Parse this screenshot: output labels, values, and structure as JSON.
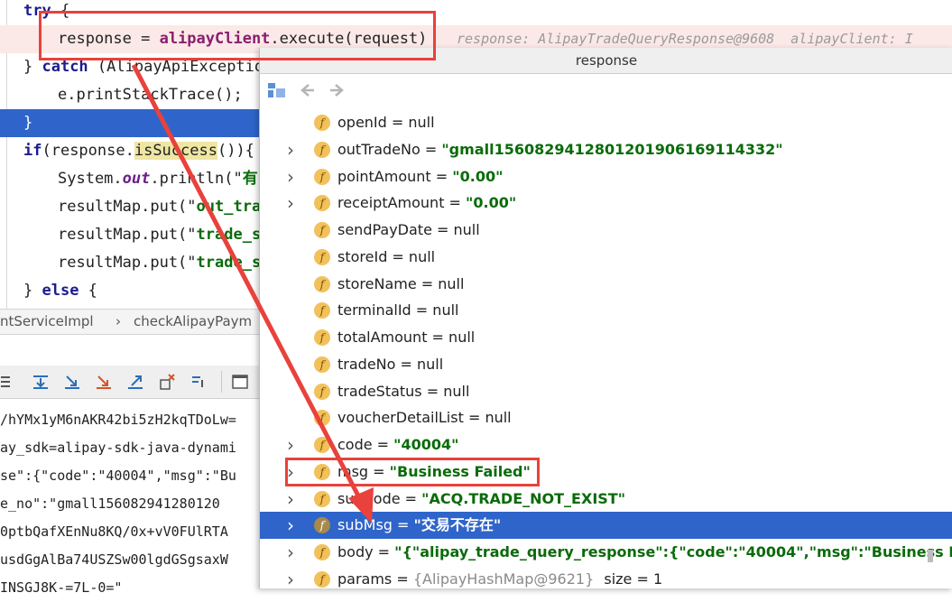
{
  "editor": {
    "lines": [
      {
        "parts": [
          {
            "t": "try",
            "c": "kw"
          },
          {
            "t": " {",
            "c": ""
          }
        ]
      },
      {
        "parts": [
          {
            "t": "response = ",
            "c": ""
          },
          {
            "t": "alipayClient",
            "c": "fn"
          },
          {
            "t": ".execute(request)",
            "c": ""
          }
        ],
        "hint": "response: AlipayTradeQueryResponse@9608  alipayClient: I"
      },
      {
        "parts": [
          {
            "t": "} ",
            "c": ""
          },
          {
            "t": "catch",
            "c": "kw"
          },
          {
            "t": " (AlipayApiExceptio",
            "c": ""
          }
        ]
      },
      {
        "parts": [
          {
            "t": "e.printStackTrace();",
            "c": ""
          }
        ]
      },
      {
        "parts": [
          {
            "t": "}",
            "c": ""
          }
        ]
      },
      {
        "parts": [
          {
            "t": "if",
            "c": "kw"
          },
          {
            "t": "(response.",
            "c": ""
          },
          {
            "t": "isSuccess",
            "c": "hl"
          },
          {
            "t": "()){",
            "c": ""
          }
        ]
      },
      {
        "parts": [
          {
            "t": "System.",
            "c": ""
          },
          {
            "t": "out",
            "c": "it"
          },
          {
            "t": ".println(\"",
            "c": ""
          },
          {
            "t": "有",
            "c": "str"
          }
        ]
      },
      {
        "parts": [
          {
            "t": "resultMap.put(\"",
            "c": ""
          },
          {
            "t": "out_tra",
            "c": "str"
          }
        ]
      },
      {
        "parts": [
          {
            "t": "resultMap.put(\"",
            "c": ""
          },
          {
            "t": "trade_s",
            "c": "str"
          }
        ]
      },
      {
        "parts": [
          {
            "t": "resultMap.put(\"",
            "c": ""
          },
          {
            "t": "trade_s",
            "c": "str"
          }
        ]
      },
      {
        "parts": [
          {
            "t": "} ",
            "c": ""
          },
          {
            "t": "else",
            "c": "kw"
          },
          {
            "t": " {",
            "c": ""
          }
        ]
      }
    ]
  },
  "breadcrumb": {
    "items": [
      "ntServiceImpl",
      "checkAlipayPaym"
    ],
    "separator": "›"
  },
  "console": {
    "lines": [
      "/hYMx1yM6nAKR42bi5zH2kqTDoLw=",
      "ay_sdk=alipay-sdk-java-dynami",
      "se\":{\"code\":\"40004\",\"msg\":\"Bu",
      "e_no\":\"gmall156082941280120",
      "0ptbQafXEnNu8KQ/0x+vV0FUlRTA",
      "usdGgAlBa74USZSw00lgdGSgsaxW",
      "INSGJ8K-=7L-0=\""
    ]
  },
  "popup": {
    "title": "response",
    "rows": [
      {
        "name": "openId",
        "value": "null",
        "type": "null",
        "expandable": false
      },
      {
        "name": "outTradeNo",
        "value": "\"gmall1560829412801201906169114332\"",
        "type": "str",
        "expandable": true
      },
      {
        "name": "pointAmount",
        "value": "\"0.00\"",
        "type": "str",
        "expandable": true
      },
      {
        "name": "receiptAmount",
        "value": "\"0.00\"",
        "type": "str",
        "expandable": true
      },
      {
        "name": "sendPayDate",
        "value": "null",
        "type": "null",
        "expandable": false
      },
      {
        "name": "storeId",
        "value": "null",
        "type": "null",
        "expandable": false
      },
      {
        "name": "storeName",
        "value": "null",
        "type": "null",
        "expandable": false
      },
      {
        "name": "terminalId",
        "value": "null",
        "type": "null",
        "expandable": false
      },
      {
        "name": "totalAmount",
        "value": "null",
        "type": "null",
        "expandable": false
      },
      {
        "name": "tradeNo",
        "value": "null",
        "type": "null",
        "expandable": false
      },
      {
        "name": "tradeStatus",
        "value": "null",
        "type": "null",
        "expandable": false
      },
      {
        "name": "voucherDetailList",
        "value": "null",
        "type": "null",
        "expandable": false
      },
      {
        "name": "code",
        "value": "\"40004\"",
        "type": "str",
        "expandable": true
      },
      {
        "name": "msg",
        "value": "\"Business Failed\"",
        "type": "str",
        "expandable": true
      },
      {
        "name": "subCode",
        "value": "\"ACQ.TRADE_NOT_EXIST\"",
        "type": "str",
        "expandable": true
      },
      {
        "name": "subMsg",
        "value": "\"交易不存在\"",
        "type": "str",
        "expandable": true,
        "selected": true
      },
      {
        "name": "body",
        "value": "\"{\"alipay_trade_query_response\":{\"code\":\"40004\",\"msg\":\"Business F...",
        "type": "str",
        "expandable": true,
        "suffix": "Vi"
      },
      {
        "name": "params",
        "value": "{AlipayHashMap@9621}",
        "type": "gray",
        "expandable": true,
        "suffix": "size = 1"
      }
    ]
  },
  "colors": {
    "highlight_red": "#e9413c",
    "selection_blue": "#2f65ca",
    "string_green": "#0a6b0a"
  },
  "icons": [
    "tree-icon",
    "back-arrow-icon",
    "forward-arrow-icon",
    "field-icon",
    "chevron-right-icon"
  ]
}
